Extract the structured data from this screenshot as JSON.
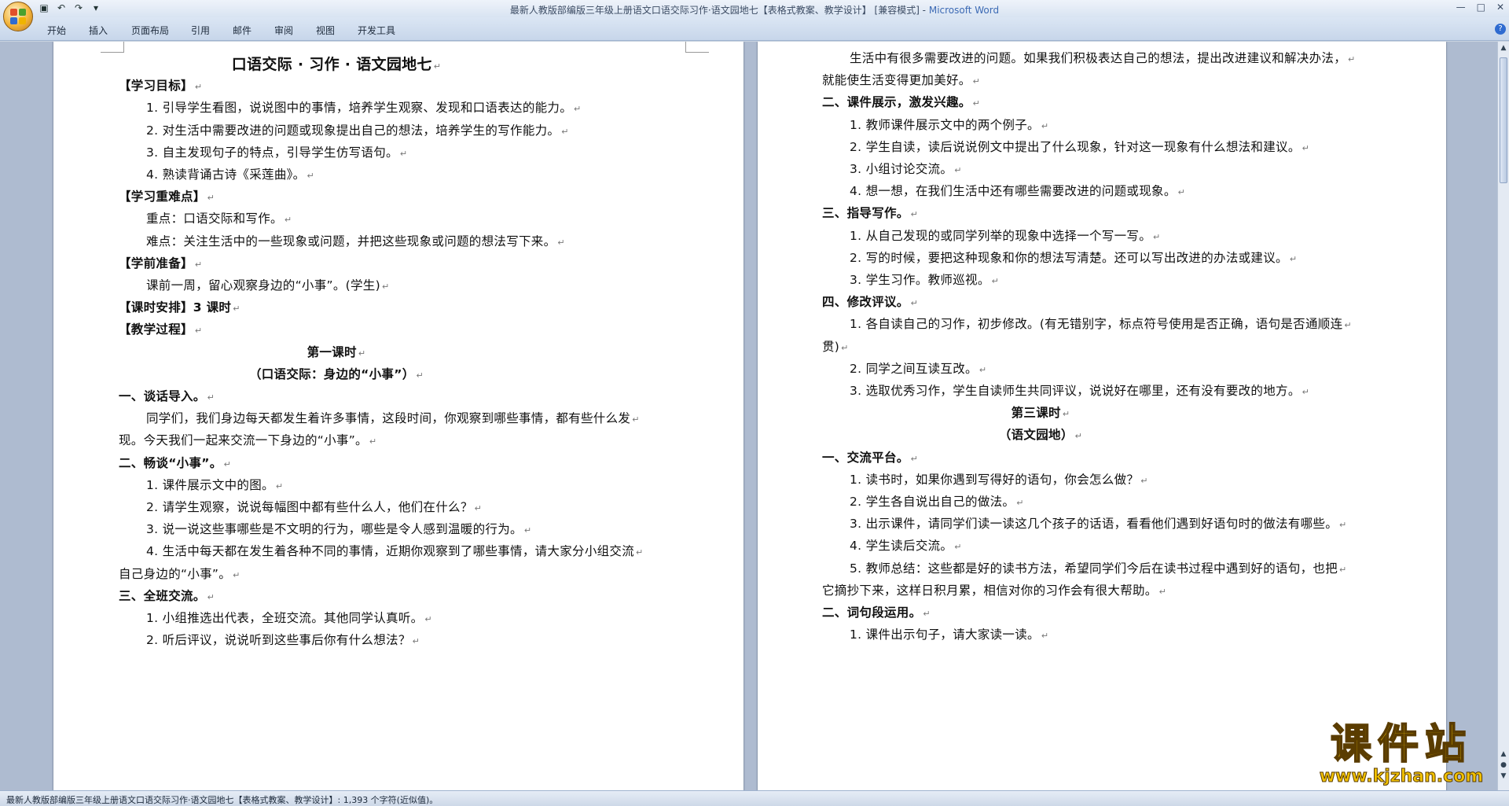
{
  "window": {
    "title": "最新人教版部编版三年级上册语文口语交际习作·语文园地七【表格式教案、教学设计】 [兼容模式] - ",
    "app": "Microsoft Word"
  },
  "ribbon_tabs": [
    "开始",
    "插入",
    "页面布局",
    "引用",
    "邮件",
    "审阅",
    "视图",
    "开发工具"
  ],
  "left_page": {
    "lines": [
      {
        "text": "口语交际 · 习作 · 语文园地七",
        "style": "title"
      },
      {
        "text": "【学习目标】",
        "style": "b",
        "indent": 0
      },
      {
        "text": "1. 引导学生看图，说说图中的事情，培养学生观察、发现和口语表达的能力。",
        "indent": 1
      },
      {
        "text": "2. 对生活中需要改进的问题或现象提出自己的想法，培养学生的写作能力。",
        "indent": 1
      },
      {
        "text": "3. 自主发现句子的特点，引导学生仿写语句。",
        "indent": 1
      },
      {
        "text": "4. 熟读背诵古诗《采莲曲》。",
        "indent": 1
      },
      {
        "text": "【学习重难点】",
        "style": "b",
        "indent": 0
      },
      {
        "text": "重点：口语交际和写作。",
        "indent": 1
      },
      {
        "text": "难点：关注生活中的一些现象或问题，并把这些现象或问题的想法写下来。",
        "indent": 1
      },
      {
        "text": "【学前准备】",
        "style": "b",
        "indent": 0
      },
      {
        "text": "课前一周，留心观察身边的“小事”。(学生)",
        "indent": 1
      },
      {
        "text": "【课时安排】3 课时",
        "style": "b",
        "indent": 0
      },
      {
        "text": "【教学过程】",
        "style": "b",
        "indent": 0
      },
      {
        "text": "第一课时",
        "style": "bc"
      },
      {
        "text": "（口语交际：身边的“小事”）",
        "style": "bc"
      },
      {
        "text": "一、谈话导入。",
        "style": "b",
        "indent": 0
      },
      {
        "text": "同学们，我们身边每天都发生着许多事情，这段时间，你观察到哪些事情，都有些什么发",
        "indent": 1
      },
      {
        "text": "现。今天我们一起来交流一下身边的“小事”。",
        "indent": 0
      },
      {
        "text": "二、畅谈“小事”。",
        "style": "b",
        "indent": 0
      },
      {
        "text": "1. 课件展示文中的图。",
        "indent": 1
      },
      {
        "text": "2. 请学生观察，说说每幅图中都有些什么人，他们在什么？",
        "indent": 1
      },
      {
        "text": "3. 说一说这些事哪些是不文明的行为，哪些是令人感到温暖的行为。",
        "indent": 1
      },
      {
        "text": "4. 生活中每天都在发生着各种不同的事情，近期你观察到了哪些事情，请大家分小组交流",
        "indent": 1
      },
      {
        "text": "自己身边的“小事”。",
        "indent": 0
      },
      {
        "text": "三、全班交流。",
        "style": "b",
        "indent": 0
      },
      {
        "text": "1. 小组推选出代表，全班交流。其他同学认真听。",
        "indent": 1
      },
      {
        "text": "2. 听后评议，说说听到这些事后你有什么想法？",
        "indent": 1
      }
    ]
  },
  "right_page": {
    "lines": [
      {
        "text": "生活中有很多需要改进的问题。如果我们积极表达自己的想法，提出改进建议和解决办法，",
        "indent": 1
      },
      {
        "text": "就能使生活变得更加美好。",
        "indent": 0
      },
      {
        "text": "二、课件展示，激发兴趣。",
        "style": "b",
        "indent": 0
      },
      {
        "text": "1. 教师课件展示文中的两个例子。",
        "indent": 1
      },
      {
        "text": "2. 学生自读，读后说说例文中提出了什么现象，针对这一现象有什么想法和建议。",
        "indent": 1
      },
      {
        "text": "3. 小组讨论交流。",
        "indent": 1
      },
      {
        "text": "4. 想一想，在我们生活中还有哪些需要改进的问题或现象。",
        "indent": 1
      },
      {
        "text": "三、指导写作。",
        "style": "b",
        "indent": 0
      },
      {
        "text": "1. 从自己发现的或同学列举的现象中选择一个写一写。",
        "indent": 1
      },
      {
        "text": "2. 写的时候，要把这种现象和你的想法写清楚。还可以写出改进的办法或建议。",
        "indent": 1
      },
      {
        "text": "3. 学生习作。教师巡视。",
        "indent": 1
      },
      {
        "text": "四、修改评议。",
        "style": "b",
        "indent": 0
      },
      {
        "text": "1. 各自读自己的习作，初步修改。(有无错别字，标点符号使用是否正确，语句是否通顺连",
        "indent": 1
      },
      {
        "text": "贯)",
        "indent": 0
      },
      {
        "text": "2. 同学之间互读互改。",
        "indent": 1
      },
      {
        "text": "3. 选取优秀习作，学生自读师生共同评议，说说好在哪里，还有没有要改的地方。",
        "indent": 1
      },
      {
        "text": "第三课时",
        "style": "bc"
      },
      {
        "text": "（语文园地）",
        "style": "bc"
      },
      {
        "text": "一、交流平台。",
        "style": "b",
        "indent": 0
      },
      {
        "text": "1. 读书时，如果你遇到写得好的语句，你会怎么做？",
        "indent": 1
      },
      {
        "text": "2. 学生各自说出自己的做法。",
        "indent": 1
      },
      {
        "text": "3. 出示课件，请同学们读一读这几个孩子的话语，看看他们遇到好语句时的做法有哪些。",
        "indent": 1
      },
      {
        "text": "4. 学生读后交流。",
        "indent": 1
      },
      {
        "text": "5. 教师总结：这些都是好的读书方法，希望同学们今后在读书过程中遇到好的语句，也把",
        "indent": 1
      },
      {
        "text": "它摘抄下来，这样日积月累，相信对你的习作会有很大帮助。",
        "indent": 0
      },
      {
        "text": "二、词句段运用。",
        "style": "b",
        "indent": 0
      },
      {
        "text": "1. 课件出示句子，请大家读一读。",
        "indent": 1
      }
    ]
  },
  "statusbar": {
    "text": "最新人教版部编版三年级上册语文口语交际习作·语文园地七【表格式教案、教学设计】: 1,393 个字符(近似值)。"
  },
  "watermark": {
    "main": "课件站",
    "url": "www.kjzhan.com"
  },
  "colors": {
    "ribbon": "#c7d6ea",
    "app_title": "#3c6ab4",
    "watermark": "#f2c200"
  }
}
